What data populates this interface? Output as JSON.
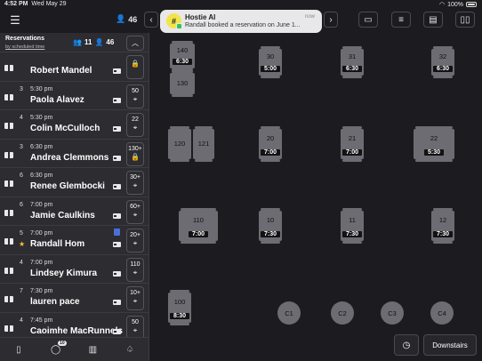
{
  "status": {
    "time": "4:52 PM",
    "date": "Wed May 29",
    "battery": "100%"
  },
  "topbar": {
    "guest_count": "46",
    "menu_icon": "menu-icon",
    "prev_icon": "chevron-left-icon",
    "next_icon": "chevron-right-icon"
  },
  "toast": {
    "avatar": "#",
    "title": "Hostie AI",
    "message": "Randall booked a reservation on June 1...",
    "time": "now"
  },
  "sidebar": {
    "title": "Reservations",
    "subtitle": "by scheduled time",
    "parties": "11",
    "guests": "46",
    "rows": [
      {
        "party": "",
        "time": "",
        "name": "Robert Mandel",
        "table": "",
        "icon": "lock"
      },
      {
        "party": "3",
        "time": "5:30 pm",
        "name": "Paola Alavez",
        "table": "50",
        "icon": "target"
      },
      {
        "party": "4",
        "time": "5:30 pm",
        "name": "Colin McCulloch",
        "table": "22",
        "icon": "target"
      },
      {
        "party": "3",
        "time": "6:30 pm",
        "name": "Andrea Clemmons",
        "table": "130+",
        "icon": "lock"
      },
      {
        "party": "6",
        "time": "6:30 pm",
        "name": "Renee Glembocki",
        "table": "30+",
        "icon": "target"
      },
      {
        "party": "6",
        "time": "7:00 pm",
        "name": "Jamie Caulkins",
        "table": "60+",
        "icon": "target"
      },
      {
        "party": "5",
        "time": "7:00 pm",
        "name": "Randall Hom",
        "table": "20+",
        "icon": "target"
      },
      {
        "party": "4",
        "time": "7:00 pm",
        "name": "Lindsey Kimura",
        "table": "110",
        "icon": "target"
      },
      {
        "party": "7",
        "time": "7:30 pm",
        "name": "lauren pace",
        "table": "10+",
        "icon": "target"
      },
      {
        "party": "4",
        "time": "7:45 pm",
        "name": "Caoimhe MacRunnels",
        "table": "50",
        "icon": "target"
      }
    ]
  },
  "bottombar": {
    "badge": "10"
  },
  "floor": {
    "tables": [
      {
        "id": "140",
        "time": "6:30"
      },
      {
        "id": "130",
        "time": ""
      },
      {
        "id": "30",
        "time": "5:00"
      },
      {
        "id": "31",
        "time": "6:30"
      },
      {
        "id": "32",
        "time": "6:30"
      },
      {
        "id": "120",
        "time": ""
      },
      {
        "id": "121",
        "time": ""
      },
      {
        "id": "20",
        "time": "7:00"
      },
      {
        "id": "21",
        "time": "7:00"
      },
      {
        "id": "22",
        "time": "5:30"
      },
      {
        "id": "110",
        "time": "7:00"
      },
      {
        "id": "10",
        "time": "7:30"
      },
      {
        "id": "11",
        "time": "7:30"
      },
      {
        "id": "12",
        "time": "7:30"
      },
      {
        "id": "100",
        "time": "8:30"
      },
      {
        "id": "C1",
        "time": ""
      },
      {
        "id": "C2",
        "time": ""
      },
      {
        "id": "C3",
        "time": ""
      },
      {
        "id": "C4",
        "time": ""
      }
    ],
    "area_label": "Downstairs"
  }
}
